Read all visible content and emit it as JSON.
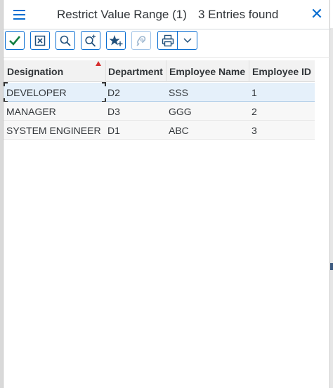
{
  "dialog": {
    "title": "Restrict Value Range (1)",
    "entries_found": "3 Entries found"
  },
  "icons": {
    "menu": "hamburger-menu-icon",
    "close": "close-icon",
    "confirm": "checkmark-icon",
    "cancel": "cancel-box-icon",
    "search": "search-icon",
    "search_more": "search-plus-icon",
    "favorite": "star-add-icon",
    "help": "hearing-help-icon",
    "print": "printer-icon",
    "dropdown": "chevron-down-icon"
  },
  "colors": {
    "accent": "#0a6ed1",
    "sort_indicator": "#d62e2e",
    "selected_row": "#e5f0fa"
  },
  "table": {
    "columns": [
      "Designation",
      "Department",
      "Employee Name",
      "Employee ID"
    ],
    "sorted_column": "Designation",
    "rows": [
      {
        "designation": "DEVELOPER",
        "department": "D2",
        "employee_name": "SSS",
        "employee_id": "1",
        "selected": true
      },
      {
        "designation": "MANAGER",
        "department": "D3",
        "employee_name": "GGG",
        "employee_id": "2",
        "selected": false
      },
      {
        "designation": "SYSTEM ENGINEER",
        "department": "D1",
        "employee_name": "ABC",
        "employee_id": "3",
        "selected": false
      }
    ]
  }
}
